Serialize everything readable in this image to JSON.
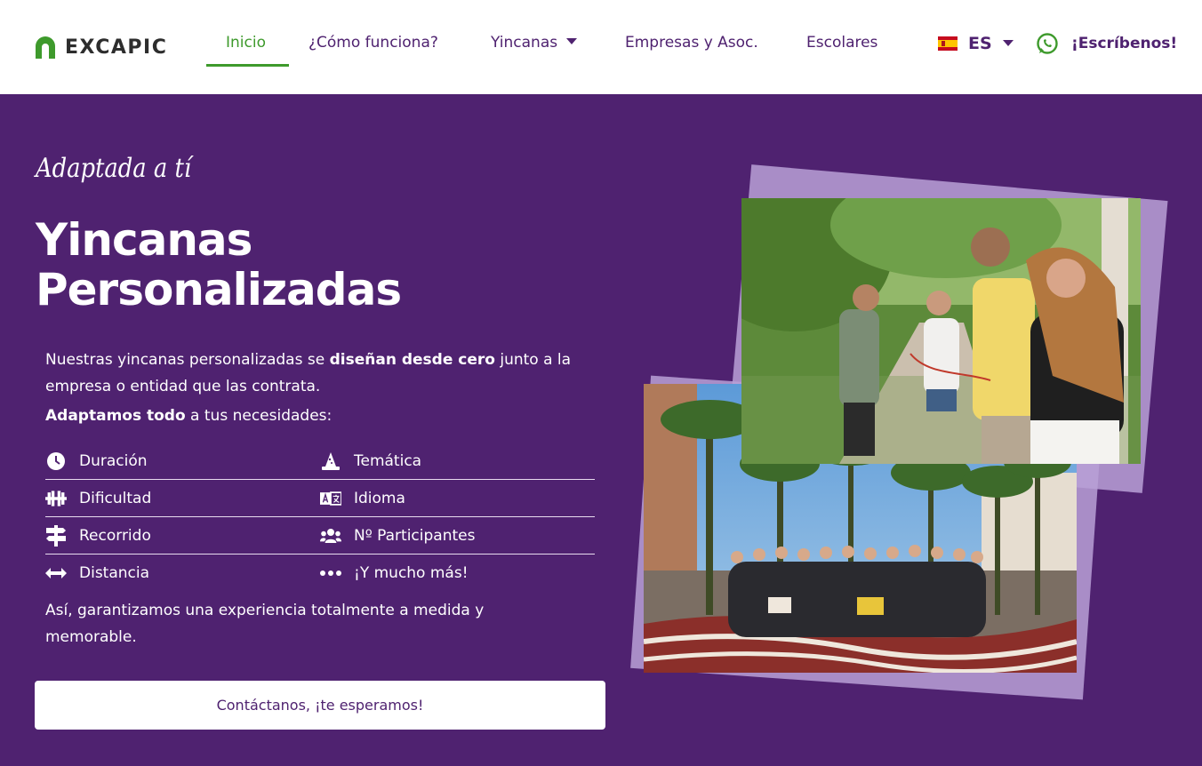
{
  "header": {
    "logo_text": "EXCAPIC",
    "nav": [
      {
        "label": "Inicio",
        "active": true
      },
      {
        "label": "¿Cómo funciona?"
      },
      {
        "label": "Yincanas",
        "has_dropdown": true
      },
      {
        "label": "Empresas y Asoc."
      },
      {
        "label": "Escolares"
      }
    ],
    "language": {
      "code": "ES",
      "flag": "spain-flag-icon"
    },
    "whatsapp_label": "¡Escríbenos!"
  },
  "hero": {
    "kicker": "Adaptada a tí",
    "title_line1": "Yincanas",
    "title_line2": "Personalizadas",
    "desc_part1": "Nuestras yincanas personalizadas se ",
    "desc_bold": "diseñan desde cero",
    "desc_part2": " junto a la empresa o entidad que las contrata.",
    "adapt_bold": "Adaptamos todo",
    "adapt_rest": " a tus necesidades:",
    "features": [
      {
        "label": "Duración",
        "icon": "clock-icon"
      },
      {
        "label": "Temática",
        "icon": "wizard-hat-icon"
      },
      {
        "label": "Dificultad",
        "icon": "dumbbell-icon"
      },
      {
        "label": "Idioma",
        "icon": "language-icon"
      },
      {
        "label": "Recorrido",
        "icon": "signpost-icon"
      },
      {
        "label": "Nº Participantes",
        "icon": "users-icon"
      },
      {
        "label": "Distancia",
        "icon": "arrows-horizontal-icon"
      },
      {
        "label": "¡Y mucho más!",
        "icon": "ellipsis-icon"
      }
    ],
    "closing": "Así, garantizamos una experiencia totalmente a medida y memorable.",
    "cta_label": "Contáctanos, ¡te esperamos!"
  },
  "colors": {
    "brand_purple": "#4f2270",
    "brand_green": "#3e9a2c",
    "card_lavender": "#b8a0d6"
  }
}
